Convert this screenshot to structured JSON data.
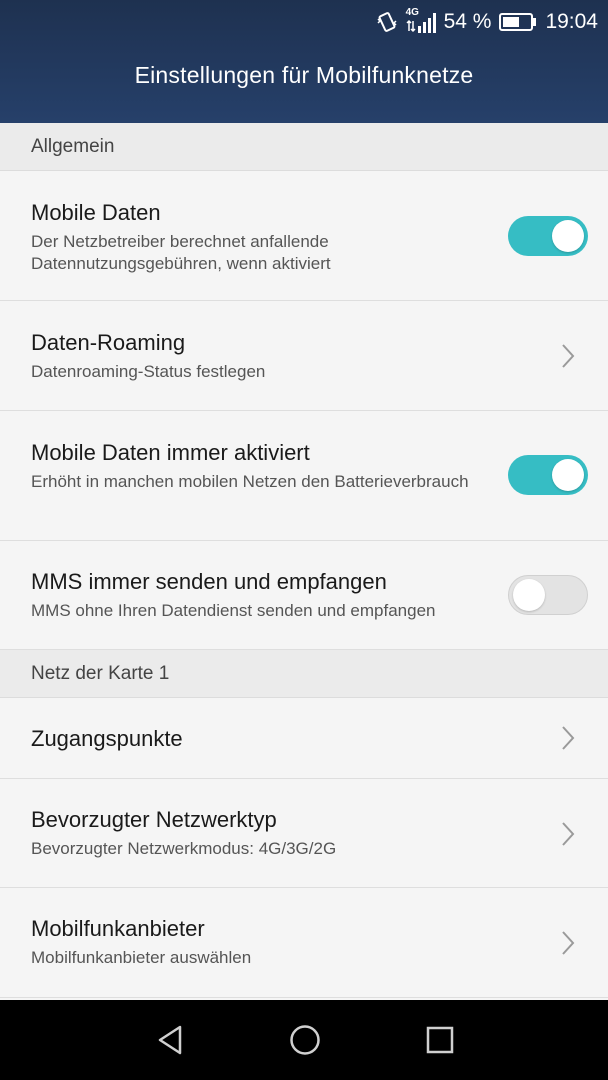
{
  "status": {
    "battery_percent": "54 %",
    "time": "19:04",
    "network_label": "4G"
  },
  "header": {
    "title": "Einstellungen für Mobilfunknetze"
  },
  "sections": {
    "general": {
      "label": "Allgemein"
    },
    "card1": {
      "label": "Netz der Karte 1"
    }
  },
  "rows": {
    "mobile_data": {
      "title": "Mobile Daten",
      "subtitle": "Der Netzbetreiber berechnet anfallende Datennutzungsgebühren, wenn aktiviert",
      "enabled": true
    },
    "roaming": {
      "title": "Daten-Roaming",
      "subtitle": "Datenroaming-Status festlegen"
    },
    "always_on": {
      "title": "Mobile Daten immer aktiviert",
      "subtitle": "Erhöht in manchen mobilen Netzen den Batterieverbrauch",
      "enabled": true
    },
    "mms": {
      "title": "MMS immer senden und empfangen",
      "subtitle": "MMS ohne Ihren Datendienst senden und empfangen",
      "enabled": false
    },
    "apn": {
      "title": "Zugangspunkte"
    },
    "network_type": {
      "title": "Bevorzugter Netzwerktyp",
      "subtitle": "Bevorzugter Netzwerkmodus: 4G/3G/2G"
    },
    "operator": {
      "title": "Mobilfunkanbieter",
      "subtitle": "Mobilfunkanbieter auswählen"
    }
  },
  "colors": {
    "accent": "#36bdc4",
    "header": "#22385c"
  },
  "icons": {
    "back": "back-triangle-icon",
    "home": "home-circle-icon",
    "recents": "recents-square-icon"
  }
}
